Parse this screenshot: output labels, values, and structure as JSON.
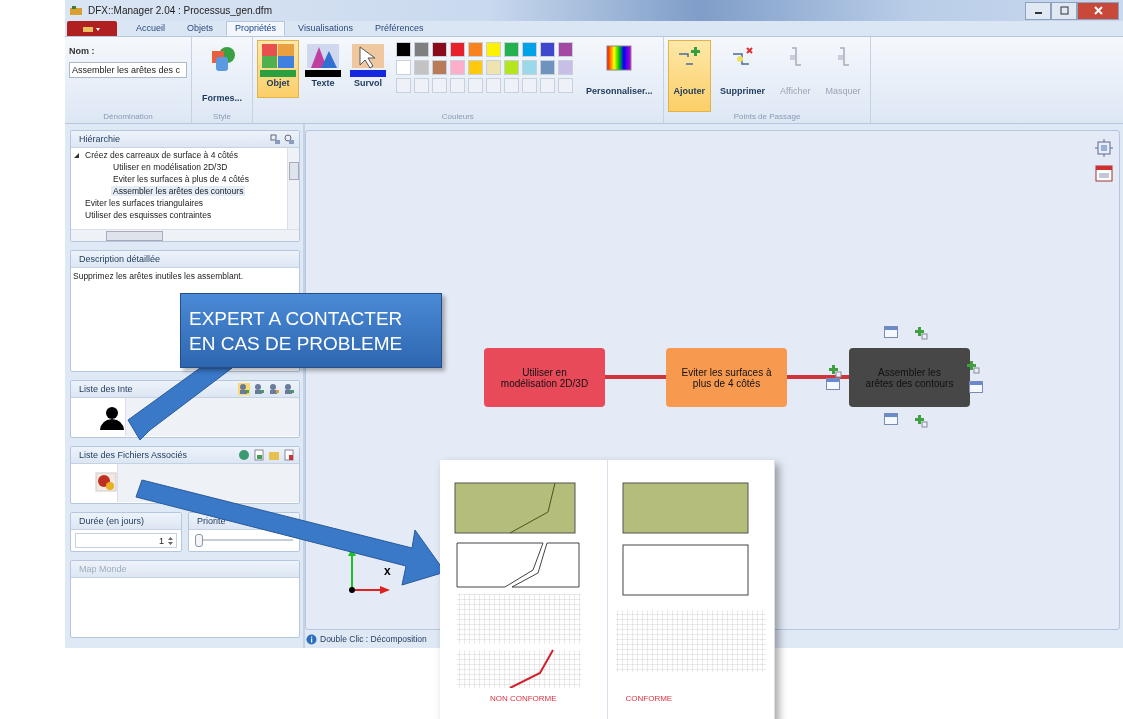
{
  "window": {
    "title": "DFX::Manager 2.04 : Processus_gen.dfm"
  },
  "tabs": [
    {
      "label": "Accueil",
      "selected": false
    },
    {
      "label": "Objets",
      "selected": false
    },
    {
      "label": "Propriétés",
      "selected": true
    },
    {
      "label": "Visualisations",
      "selected": false
    },
    {
      "label": "Préférences",
      "selected": false
    }
  ],
  "ribbon": {
    "name_group": {
      "label": "Nom :",
      "value": "Assembler les arêtes des c",
      "caption": "Dénomination"
    },
    "style_group": {
      "button": "Formes...",
      "caption": "Style"
    },
    "color_group": {
      "targets": [
        {
          "label": "Objet",
          "selected": true,
          "color": "#2aa040"
        },
        {
          "label": "Texte",
          "selected": false,
          "color": "#000000"
        },
        {
          "label": "Survol",
          "selected": false,
          "color": "#1428e0"
        }
      ],
      "swatches": [
        [
          {
            "kind": "color",
            "color": "#000000"
          },
          {
            "kind": "color",
            "color": "#7f7f7f"
          },
          {
            "kind": "color",
            "color": "#8b0a1a"
          },
          {
            "kind": "color",
            "color": "#e8202a"
          },
          {
            "kind": "color",
            "color": "#f7821e"
          },
          {
            "kind": "color",
            "color": "#fff200"
          },
          {
            "kind": "color",
            "color": "#22b14c"
          },
          {
            "kind": "color",
            "color": "#00a2e8"
          },
          {
            "kind": "color",
            "color": "#3f48cc"
          },
          {
            "kind": "color",
            "color": "#a349a4"
          }
        ],
        [
          {
            "kind": "color",
            "color": "#ffffff"
          },
          {
            "kind": "color",
            "color": "#c3c3c3"
          },
          {
            "kind": "color",
            "color": "#b97a57"
          },
          {
            "kind": "color",
            "color": "#ffaec9"
          },
          {
            "kind": "color",
            "color": "#ffc90e"
          },
          {
            "kind": "color",
            "color": "#efe4b0"
          },
          {
            "kind": "color",
            "color": "#b5e61d"
          },
          {
            "kind": "color",
            "color": "#99d9ea"
          },
          {
            "kind": "color",
            "color": "#7092be"
          },
          {
            "kind": "color",
            "color": "#c8bfe7"
          }
        ],
        [
          {
            "kind": "empty"
          },
          {
            "kind": "empty"
          },
          {
            "kind": "empty"
          },
          {
            "kind": "empty"
          },
          {
            "kind": "empty"
          },
          {
            "kind": "empty"
          },
          {
            "kind": "empty"
          },
          {
            "kind": "empty"
          },
          {
            "kind": "empty"
          },
          {
            "kind": "empty"
          }
        ]
      ],
      "custom_button": "Personnaliser...",
      "caption": "Couleurs"
    },
    "passage_group": {
      "buttons": [
        {
          "label": "Ajouter",
          "selected": true,
          "disabled": false
        },
        {
          "label": "Supprimer",
          "selected": false,
          "disabled": false
        },
        {
          "label": "Afficher",
          "selected": false,
          "disabled": true
        },
        {
          "label": "Masquer",
          "selected": false,
          "disabled": true
        }
      ],
      "caption": "Points de Passage"
    }
  },
  "left_panel": {
    "hierarchy": {
      "title": "Hiérarchie",
      "items": [
        {
          "label": "Créez des carreaux de surface à 4 côtés",
          "selected": false,
          "expanded": true,
          "children": [
            {
              "label": "Utiliser en modélisation 2D/3D",
              "selected": false
            },
            {
              "label": "Eviter les surfaces à plus de 4 côtés",
              "selected": false
            },
            {
              "label": "Assembler les arêtes des contours",
              "selected": true
            }
          ]
        },
        {
          "label": "Eviter les surfaces triangulaires",
          "selected": false
        },
        {
          "label": "Utiliser des esquisses contraintes",
          "selected": false
        }
      ]
    },
    "description": {
      "title": "Description détaillée",
      "text": "Supprimez les arêtes inutiles les assemblant."
    },
    "participants": {
      "title": "Liste des Inte"
    },
    "files": {
      "title": "Liste des Fichiers Associés"
    },
    "duration": {
      "title": "Durée (en jours)",
      "value": "1"
    },
    "priority": {
      "title": "Priorité",
      "level": 0
    },
    "world_map": {
      "title": "Map Monde",
      "disabled": true
    }
  },
  "canvas": {
    "nodes": [
      {
        "label": "Utiliser en modélisation 2D/3D",
        "color": "#e84a5a"
      },
      {
        "label": "Eviter les surfaces à plus de 4 côtés",
        "color": "#f79a50"
      },
      {
        "label": "Assembler les arêtes des contours",
        "color": "#474747"
      }
    ],
    "axis_label": "x",
    "status": "Double Clic : Décomposition"
  },
  "callout": {
    "lines": [
      "EXPERT A CONTACTER",
      "EN CAS DE PROBLEME"
    ]
  },
  "inset": {
    "columns": [
      {
        "verdict": "NON CONFORME"
      },
      {
        "verdict": "CONFORME"
      }
    ]
  }
}
